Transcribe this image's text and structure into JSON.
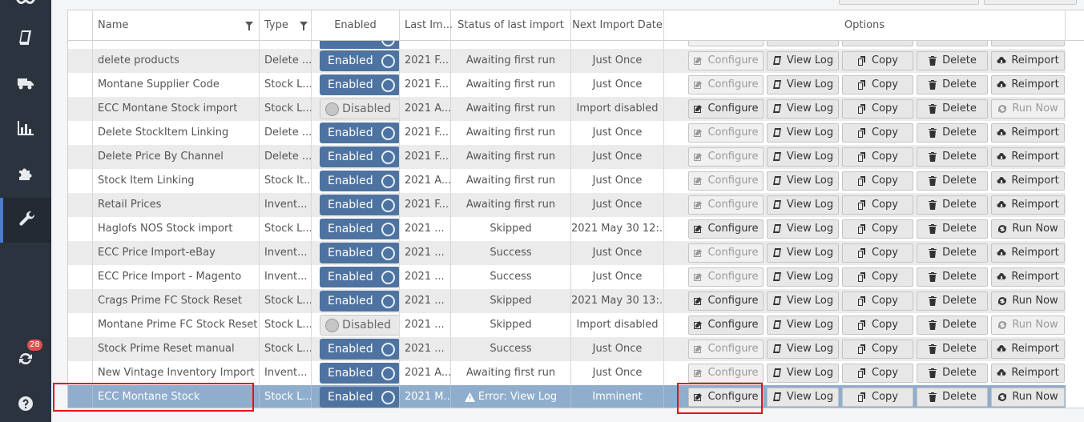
{
  "sidebar": {
    "items": [
      {
        "icon": "logo-icon"
      },
      {
        "icon": "book-icon"
      },
      {
        "icon": "truck-icon"
      },
      {
        "icon": "bar-chart-icon"
      },
      {
        "icon": "puzzle-icon"
      },
      {
        "icon": "wrench-icon",
        "active": true
      },
      {
        "icon": "sync-icon",
        "badge": "28"
      },
      {
        "icon": "help-icon"
      }
    ]
  },
  "grid": {
    "columns": {
      "name": "Name",
      "type": "Type",
      "enabled": "Enabled",
      "last_import": "Last Im...",
      "status": "Status of last import",
      "next": "Next Import Date",
      "options": "Options"
    },
    "buttons": {
      "configure": "Configure",
      "view_log": "View Log",
      "copy": "Copy",
      "delete": "Delete",
      "reimport": "Reimport",
      "run_now": "Run Now"
    },
    "rows": [
      {
        "name": "delete products",
        "type": "Delete ...",
        "enabled": "Enabled",
        "on": true,
        "last": "2021 F...",
        "status": "Awaiting first run",
        "next": "Just Once",
        "configure_enabled": false,
        "action": "Reimport",
        "action_enabled": true
      },
      {
        "name": "Montane Supplier Code",
        "type": "Stock L...",
        "enabled": "Enabled",
        "on": true,
        "last": "2021 F...",
        "status": "Awaiting first run",
        "next": "Just Once",
        "configure_enabled": false,
        "action": "Reimport",
        "action_enabled": true
      },
      {
        "name": "ECC Montane Stock import",
        "type": "Stock L...",
        "enabled": "Disabled",
        "on": false,
        "last": "2021 A...",
        "status": "Awaiting first run",
        "next": "Import disabled",
        "configure_enabled": true,
        "action": "Run Now",
        "action_enabled": false
      },
      {
        "name": "Delete StockItem Linking",
        "type": "Delete ...",
        "enabled": "Enabled",
        "on": true,
        "last": "2021 F...",
        "status": "Awaiting first run",
        "next": "Just Once",
        "configure_enabled": false,
        "action": "Reimport",
        "action_enabled": true
      },
      {
        "name": "Delete Price By Channel",
        "type": "Delete ...",
        "enabled": "Enabled",
        "on": true,
        "last": "2021 F...",
        "status": "Awaiting first run",
        "next": "Just Once",
        "configure_enabled": false,
        "action": "Reimport",
        "action_enabled": true
      },
      {
        "name": "Stock Item Linking",
        "type": "Stock It...",
        "enabled": "Enabled",
        "on": true,
        "last": "2021 A...",
        "status": "Awaiting first run",
        "next": "Just Once",
        "configure_enabled": false,
        "action": "Reimport",
        "action_enabled": true
      },
      {
        "name": "Retail Prices",
        "type": "Invent...",
        "enabled": "Enabled",
        "on": true,
        "last": "2021 F...",
        "status": "Awaiting first run",
        "next": "Just Once",
        "configure_enabled": false,
        "action": "Reimport",
        "action_enabled": true
      },
      {
        "name": "Haglofs NOS Stock import",
        "type": "Stock L...",
        "enabled": "Enabled",
        "on": true,
        "last": "2021 ...",
        "status": "Skipped",
        "next": "2021 May 30 12:...",
        "configure_enabled": true,
        "action": "Run Now",
        "action_enabled": true
      },
      {
        "name": "ECC Price Import-eBay",
        "type": "Invent...",
        "enabled": "Enabled",
        "on": true,
        "last": "2021 ...",
        "status": "Success",
        "next": "Just Once",
        "configure_enabled": false,
        "action": "Reimport",
        "action_enabled": true
      },
      {
        "name": "ECC Price Import - Magento",
        "type": "Invent...",
        "enabled": "Enabled",
        "on": true,
        "last": "2021 ...",
        "status": "Success",
        "next": "Just Once",
        "configure_enabled": false,
        "action": "Reimport",
        "action_enabled": true
      },
      {
        "name": "Crags Prime FC Stock Reset",
        "type": "Stock L...",
        "enabled": "Enabled",
        "on": true,
        "last": "2021 ...",
        "status": "Skipped",
        "next": "2021 May 30 13:...",
        "configure_enabled": true,
        "action": "Run Now",
        "action_enabled": true
      },
      {
        "name": "Montane Prime FC Stock Reset",
        "type": "Stock L...",
        "enabled": "Disabled",
        "on": false,
        "last": "2021 ...",
        "status": "Skipped",
        "next": "Import disabled",
        "configure_enabled": true,
        "action": "Run Now",
        "action_enabled": false
      },
      {
        "name": "Stock Prime Reset manual",
        "type": "Stock L...",
        "enabled": "Enabled",
        "on": true,
        "last": "2021 ...",
        "status": "Success",
        "next": "Just Once",
        "configure_enabled": false,
        "action": "Reimport",
        "action_enabled": true
      },
      {
        "name": "New Vintage Inventory Import",
        "type": "Invent...",
        "enabled": "Enabled",
        "on": true,
        "last": "2021 A...",
        "status": "Awaiting first run",
        "next": "Just Once",
        "configure_enabled": false,
        "action": "Reimport",
        "action_enabled": true
      },
      {
        "name": "ECC Montane Stock",
        "type": "Stock L...",
        "enabled": "Enabled",
        "on": true,
        "last": "2021 M...",
        "status": "Error: View Log",
        "error": true,
        "next": "Imminent",
        "configure_enabled": true,
        "action": "Run Now",
        "action_enabled": true,
        "selected": true
      }
    ]
  },
  "colors": {
    "sidebar_bg": "#2b333e",
    "toggle_on": "#4e73a0",
    "selected_row": "#8fadcc",
    "highlight": "#e0141c"
  }
}
